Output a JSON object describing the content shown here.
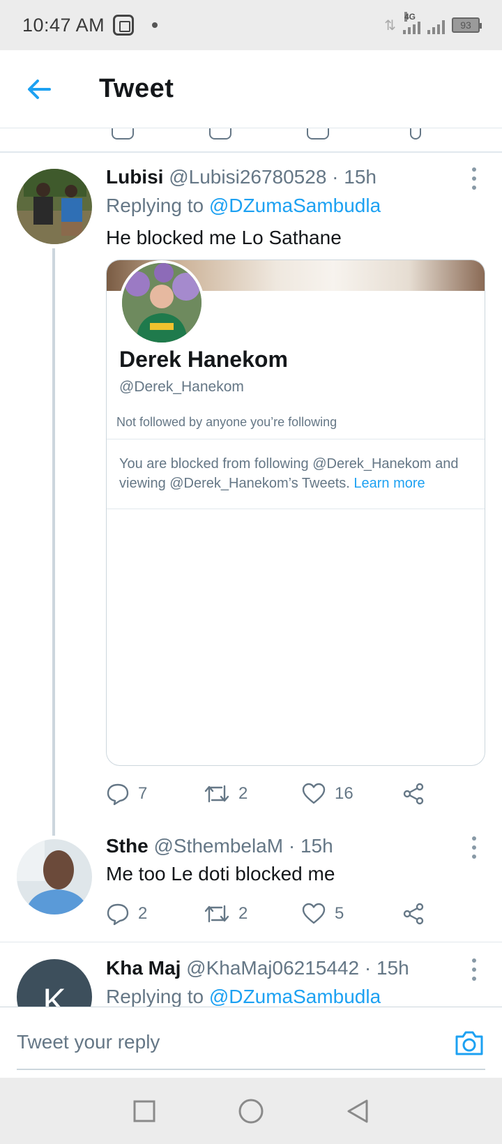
{
  "status_bar": {
    "time": "10:47 AM",
    "network": "4G",
    "battery": "93"
  },
  "app_bar": {
    "title": "Tweet"
  },
  "tweets": [
    {
      "name": "Lubisi",
      "meta": "@Lubisi26780528 · 15h",
      "replying_prefix": "Replying to ",
      "replying_handle": "@DZumaSambudla",
      "text": "He blocked me Lo Sathane",
      "card": {
        "name": "Derek Hanekom",
        "handle": "@Derek_Hanekom",
        "follow_status": "Not followed by anyone you’re following",
        "blocked_notice": "You are blocked from following @Derek_Hanekom and viewing @Derek_Hanekom’s Tweets. ",
        "learn_more": "Learn more"
      },
      "replies": "7",
      "retweets": "2",
      "likes": "16"
    },
    {
      "name": "Sthe",
      "meta": "@SthembelaM · 15h",
      "text": "Me too Le doti blocked me",
      "replies": "2",
      "retweets": "2",
      "likes": "5"
    },
    {
      "name": "Kha Maj",
      "meta": "@KhaMaj06215442 · 15h",
      "avatar_letter": "K",
      "replying_prefix": "Replying to ",
      "replying_handle": "@DZumaSambudla"
    }
  ],
  "reply_bar": {
    "placeholder": "Tweet your reply"
  },
  "colors": {
    "accent": "#1da1f2",
    "secondary_text": "#657786",
    "divider": "#e1e8ed"
  },
  "icons": [
    "back-arrow-icon",
    "more-vertical-icon",
    "reply-icon",
    "retweet-icon",
    "like-icon",
    "share-icon",
    "camera-icon",
    "square-nav-icon",
    "circle-nav-icon",
    "triangle-back-nav-icon"
  ]
}
